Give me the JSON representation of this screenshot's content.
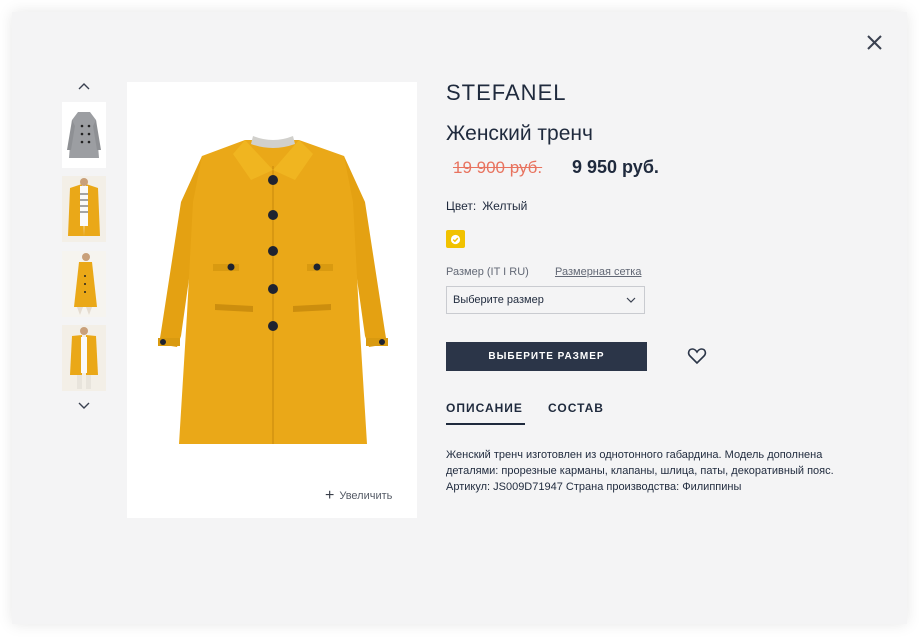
{
  "product": {
    "brand": "STEFANEL",
    "title": "Женский тренч",
    "old_price": "19 900 руб.",
    "new_price": "9 950 руб.",
    "color_label": "Цвет:",
    "color_value": "Желтый",
    "swatch_color": "#f1c200",
    "size_label": "Размер (IT I RU)",
    "size_chart_link": "Размерная сетка",
    "size_select_value": "Выберите размер",
    "buy_button": "ВЫБЕРИТЕ РАЗМЕР",
    "zoom_label": "Увеличить"
  },
  "tabs": [
    {
      "label": "ОПИСАНИЕ",
      "active": true
    },
    {
      "label": "СОСТАВ",
      "active": false
    }
  ],
  "description": {
    "line1": "Женский тренч изготовлен из однотонного габардина. Модель дополнена",
    "line2": "деталями: прорезные карманы, клапаны, шлица, паты, декоративный пояс.",
    "line3": "Артикул: JS009D71947 Страна производства: Филиппины"
  },
  "colors": {
    "accent_dark": "#2b3548",
    "old_price": "#e8735f",
    "coat_yellow": "#eaa818"
  },
  "icons": {
    "close": "close-icon",
    "thumbs_up": "chevron-up-icon",
    "thumbs_down": "chevron-down-icon",
    "heart": "heart-icon",
    "zoom": "plus-icon",
    "select": "chevron-down-icon"
  }
}
